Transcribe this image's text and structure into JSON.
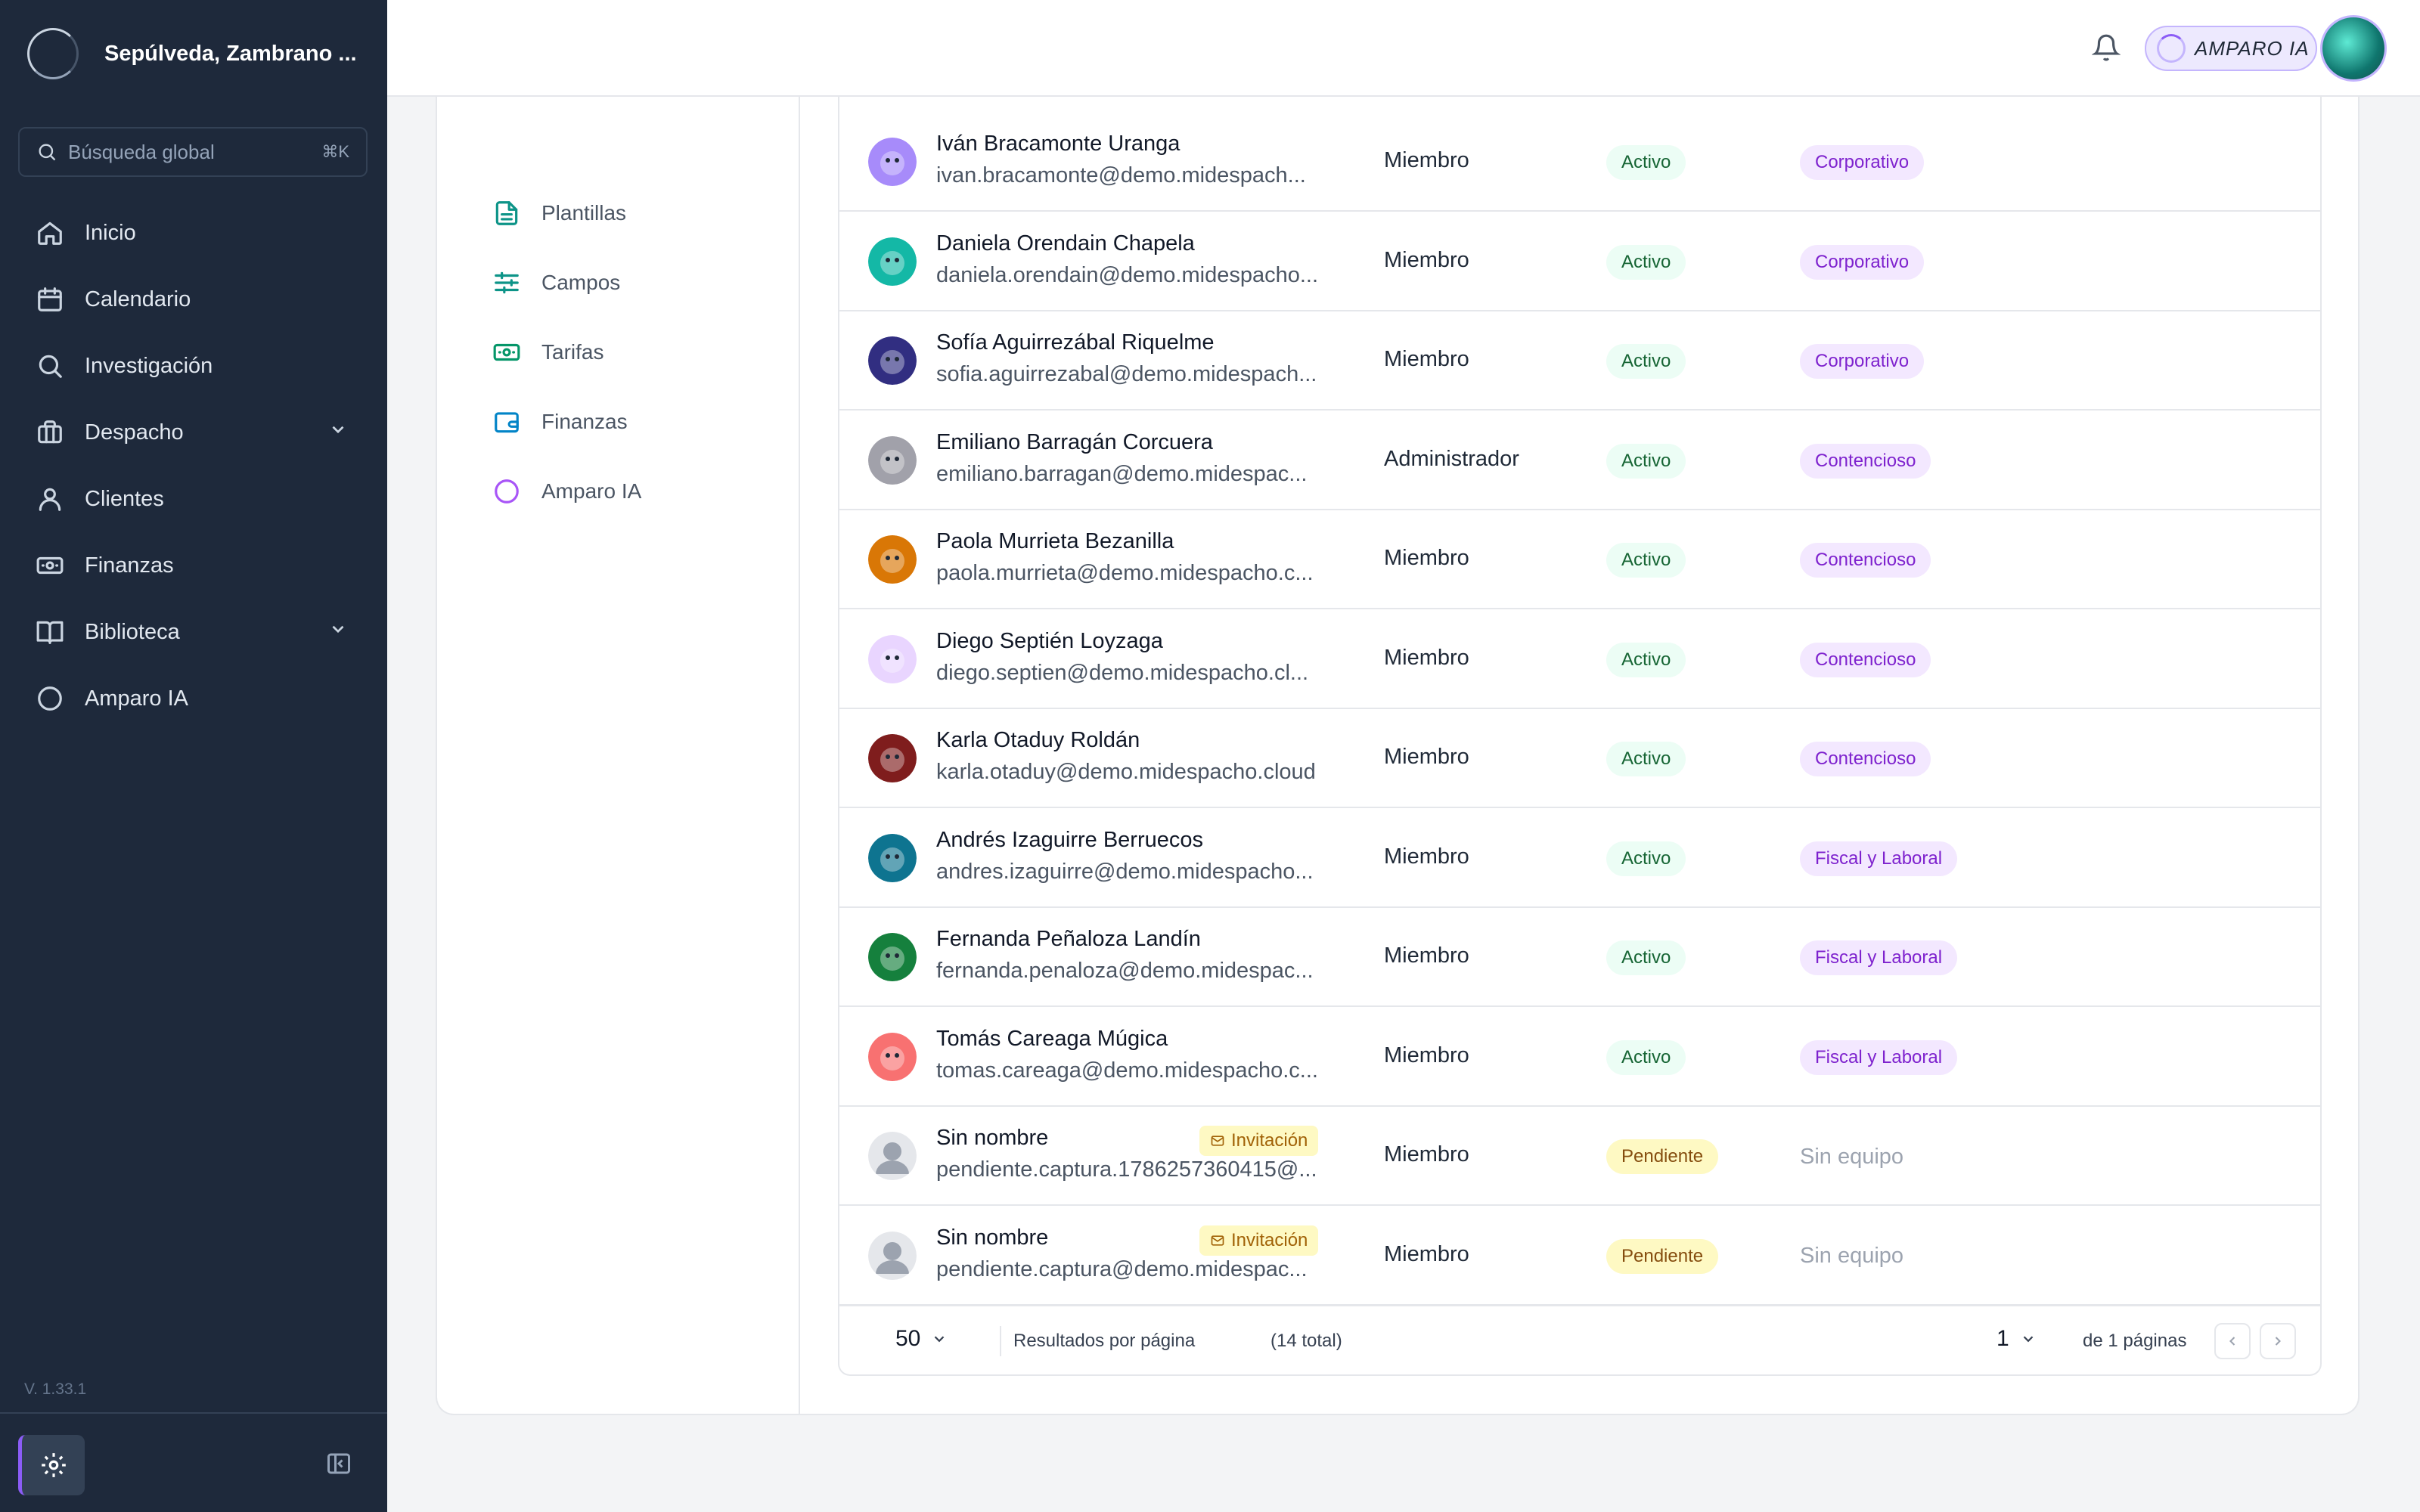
{
  "org": {
    "name": "Sepúlveda, Zambrano ..."
  },
  "search": {
    "placeholder": "Búsqueda global",
    "shortcut": "⌘K"
  },
  "nav": [
    {
      "label": "Inicio",
      "icon": "home-icon"
    },
    {
      "label": "Calendario",
      "icon": "calendar-icon"
    },
    {
      "label": "Investigación",
      "icon": "search-icon"
    },
    {
      "label": "Despacho",
      "icon": "briefcase-icon",
      "expandable": true
    },
    {
      "label": "Clientes",
      "icon": "user-icon"
    },
    {
      "label": "Finanzas",
      "icon": "banknote-icon"
    },
    {
      "label": "Biblioteca",
      "icon": "book-icon",
      "expandable": true
    },
    {
      "label": "Amparo IA",
      "icon": "amparo-ring-icon"
    }
  ],
  "version": "V. 1.33.1",
  "topbar": {
    "amparo_label": "AMPARO IA"
  },
  "subnav": [
    {
      "label": "Plantillas",
      "icon": "document-icon"
    },
    {
      "label": "Campos",
      "icon": "sliders-icon"
    },
    {
      "label": "Tarifas",
      "icon": "banknote-icon"
    },
    {
      "label": "Finanzas",
      "icon": "wallet-icon"
    },
    {
      "label": "Amparo IA",
      "icon": "amparo-ring-icon"
    }
  ],
  "members": [
    {
      "name": "Iván Bracamonte Uranga",
      "email": "ivan.bracamonte@demo.midespach...",
      "role": "Miembro",
      "status": "Activo",
      "team": "Corporativo",
      "avatar_color": "#a78bfa"
    },
    {
      "name": "Daniela Orendain Chapela",
      "email": "daniela.orendain@demo.midespacho...",
      "role": "Miembro",
      "status": "Activo",
      "team": "Corporativo",
      "avatar_color": "#14b8a6"
    },
    {
      "name": "Sofía Aguirrezábal Riquelme",
      "email": "sofia.aguirrezabal@demo.midespach...",
      "role": "Miembro",
      "status": "Activo",
      "team": "Corporativo",
      "avatar_color": "#312e81"
    },
    {
      "name": "Emiliano Barragán Corcuera",
      "email": "emiliano.barragan@demo.midespac...",
      "role": "Administrador",
      "status": "Activo",
      "team": "Contencioso",
      "avatar_color": "#a1a1aa"
    },
    {
      "name": "Paola Murrieta Bezanilla",
      "email": "paola.murrieta@demo.midespacho.c...",
      "role": "Miembro",
      "status": "Activo",
      "team": "Contencioso",
      "avatar_color": "#d97706"
    },
    {
      "name": "Diego Septién Loyzaga",
      "email": "diego.septien@demo.midespacho.cl...",
      "role": "Miembro",
      "status": "Activo",
      "team": "Contencioso",
      "avatar_color": "#e9d5ff"
    },
    {
      "name": "Karla Otaduy Roldán",
      "email": "karla.otaduy@demo.midespacho.cloud",
      "role": "Miembro",
      "status": "Activo",
      "team": "Contencioso",
      "avatar_color": "#7f1d1d"
    },
    {
      "name": "Andrés Izaguirre Berruecos",
      "email": "andres.izaguirre@demo.midespacho...",
      "role": "Miembro",
      "status": "Activo",
      "team": "Fiscal y Laboral",
      "avatar_color": "#0e7490"
    },
    {
      "name": "Fernanda Peñaloza Landín",
      "email": "fernanda.penaloza@demo.midespac...",
      "role": "Miembro",
      "status": "Activo",
      "team": "Fiscal y Laboral",
      "avatar_color": "#15803d"
    },
    {
      "name": "Tomás Careaga Múgica",
      "email": "tomas.careaga@demo.midespacho.c...",
      "role": "Miembro",
      "status": "Activo",
      "team": "Fiscal y Laboral",
      "avatar_color": "#f87171"
    },
    {
      "name": "Sin nombre",
      "email": "pendiente.captura.1786257360415@...",
      "role": "Miembro",
      "status": "Pendiente",
      "team": "Sin equipo",
      "invite": "Invitación",
      "avatar_color": "#e5e7eb"
    },
    {
      "name": "Sin nombre",
      "email": "pendiente.captura@demo.midespac...",
      "role": "Miembro",
      "status": "Pendiente",
      "team": "Sin equipo",
      "invite": "Invitación",
      "avatar_color": "#e5e7eb"
    }
  ],
  "pagination": {
    "page_size": "50",
    "per_page_label": "Resultados por página",
    "total_label": "(14 total)",
    "current_page": "1",
    "of_pages_label": "de 1 páginas"
  },
  "colors": {
    "sidebar": "#1e293b",
    "accent": "#8b5cf6",
    "active_badge": "#ecfdf5",
    "pending_badge": "#fef9c3",
    "team_badge": "#f3e8ff"
  }
}
